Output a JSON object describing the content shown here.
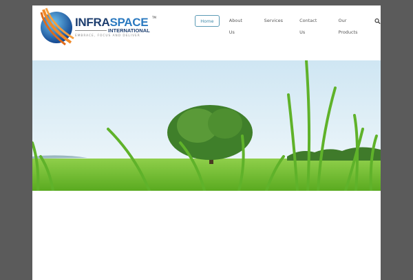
{
  "logo": {
    "brand_part1": "INFRA",
    "brand_part2": "SPACE",
    "trademark": "TM",
    "subtitle": "INTERNATIONAL",
    "tagline": "EMBRACE, FOCUS AND DELIVER"
  },
  "nav": {
    "items": [
      {
        "label": "Home",
        "active": true
      },
      {
        "label": "About Us"
      },
      {
        "label": "Services"
      },
      {
        "label": "Contact Us"
      },
      {
        "label": "Our Products"
      }
    ],
    "search_icon": "search-icon"
  },
  "colors": {
    "accent": "#3e88a8",
    "brand": "#1c3d6e"
  }
}
